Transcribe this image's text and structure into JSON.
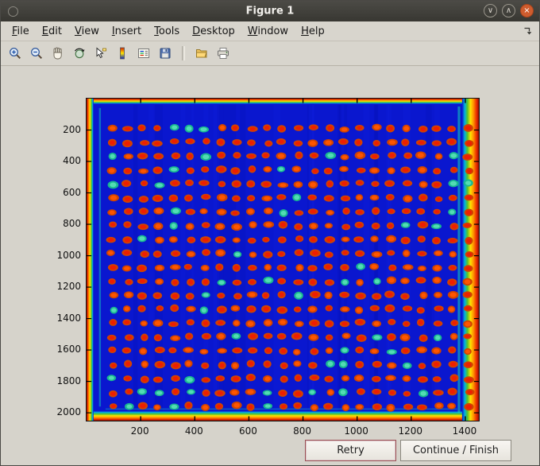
{
  "window": {
    "title": "Figure 1"
  },
  "titlebar": {
    "minimize_glyph": "∨",
    "maximize_glyph": "∧",
    "close_glyph": "×"
  },
  "menubar": {
    "items": [
      "File",
      "Edit",
      "View",
      "Insert",
      "Tools",
      "Desktop",
      "Window",
      "Help"
    ]
  },
  "toolbar": {
    "tools": [
      "zoom-in",
      "zoom-out",
      "pan",
      "rotate-3d",
      "data-cursor",
      "insert-colorbar",
      "insert-legend",
      "save-figure",
      "separator",
      "open-folder",
      "print-figure"
    ]
  },
  "buttons": {
    "retry": "Retry",
    "continue": "Continue / Finish"
  },
  "chart_data": {
    "type": "heatmap",
    "title": "",
    "xlabel": "",
    "ylabel": "",
    "x_ticks": [
      200,
      400,
      600,
      800,
      1000,
      1200,
      1400
    ],
    "y_ticks": [
      200,
      400,
      600,
      800,
      1000,
      1200,
      1400,
      1600,
      1800,
      2000
    ],
    "x_range": [
      0,
      1450
    ],
    "y_range": [
      0,
      2050
    ],
    "grid": {
      "rows": 21,
      "cols": 24,
      "x_start": 95,
      "x_end": 1412,
      "y_start": 190,
      "y_end": 1960
    },
    "colors": {
      "background": "#0a17cf",
      "spot_ring": "#d04400",
      "spot_core": "#ee1e00",
      "spot_core_alt": "#ff5500",
      "spot_green_ring": "#18b890",
      "spot_green_core": "#52dcb4",
      "streak": "#10d8b8",
      "edge": [
        "#8e1000",
        "#e62500",
        "#ff9000",
        "#ffe300",
        "#53c32c",
        "#00b2e0"
      ]
    },
    "description": "Plate-scan intensity image (jet colormap): dark blue field with a 21 x 24 grid of red spots and warm red/orange saturated borders"
  }
}
